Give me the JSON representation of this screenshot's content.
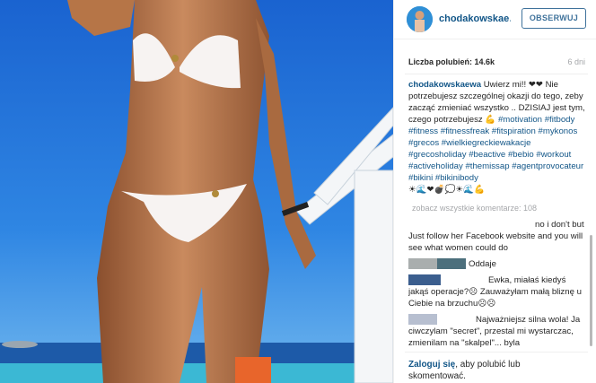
{
  "post": {
    "username": "chodakowskaewa",
    "username_display": "chodakowskae…",
    "follow_label": "OBSERWUJ",
    "likes_label": "Liczba polubień:",
    "likes_count": "14.6k",
    "age": "6 dni"
  },
  "caption": {
    "user": "chodakowskaewa",
    "text": "Uwierz mi!! ❤❤ Nie potrzebujesz szczególnej okazji do tego, zeby zacząć zmieniać wszystko .. DZISIAJ jest tym, czego potrzebujesz 💪",
    "hashtags": [
      "#motivation",
      "#fitbody",
      "#fitness",
      "#fitnessfreak",
      "#fitspiration",
      "#mykonos",
      "#grecos",
      "#wielkiegreckiewakacje",
      "#grecosholiday",
      "#beactive",
      "#bebio",
      "#workout",
      "#activeholiday",
      "#themissap",
      "#agentprovocateur",
      "#bikini",
      "#bikinibody"
    ],
    "emoji": "☀🌊❤💣💭☀🌊💪"
  },
  "view_all_label": "zobacz wszystkie komentarze: 108",
  "comments": [
    {
      "text": "no i don't but Just follow her Facebook website and you will see what women could do"
    },
    {
      "text": "Oddaje"
    },
    {
      "text": "Ewka, miałaś kiedyś jakąś operacje?☹ Zauważyłam małą bliznę u Ciebie na brzuchu☹☹"
    },
    {
      "text": "Najważniejsz silna wola! Ja ciwczylam \"secret\", przestal mi wystarczac, zmienilam na \"skalpel\"... byla"
    }
  ],
  "footer": {
    "login_link": "Zaloguj się",
    "login_rest": ", aby polubić lub skomentować."
  },
  "colors": {
    "link_blue": "#125688",
    "button_blue": "#3f729b",
    "sky": "#1f73d6",
    "sea": "#3bb8d4"
  }
}
